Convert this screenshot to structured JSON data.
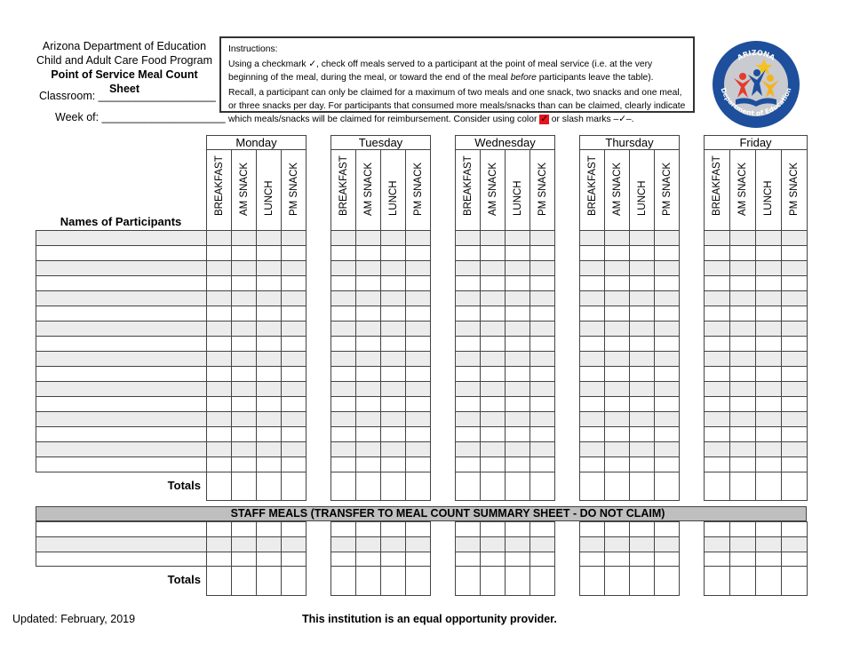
{
  "header": {
    "org": "Arizona Department of Education",
    "program": "Child and Adult Care Food Program",
    "title": "Point of Service Meal Count Sheet",
    "classroom_label": "Classroom: ___________________",
    "week_label": "Week of: ____________________"
  },
  "instructions": {
    "heading": "Instructions:",
    "p1_a": "Using a checkmark ✓, check off meals served to a participant at the point of meal service (i.e. at the very beginning of the meal, during the meal, or toward the end of the meal ",
    "p1_em": "before",
    "p1_b": " participants leave the table).",
    "p2_a": "Recall, a participant can only be claimed for a maximum of two meals and one snack, two snacks and one meal, or three snacks per day. For participants that consumed more meals/snacks than can be claimed, clearly indicate which meals/snacks will be claimed for reimbursement. Consider using color ",
    "p2_check": "✓",
    "p2_b": " or slash marks ",
    "p2_slash": "–✓–",
    "p2_c": "."
  },
  "logo": {
    "text_top": "ARIZONA",
    "text_bottom": "Department of Education"
  },
  "table": {
    "names_header": "Names of Participants",
    "days": [
      "Monday",
      "Tuesday",
      "Wednesday",
      "Thursday",
      "Friday"
    ],
    "meals": [
      "BREAKFAST",
      "AM SNACK",
      "LUNCH",
      "PM SNACK"
    ],
    "totals_label": "Totals",
    "staff_header": "STAFF MEALS (TRANSFER TO MEAL COUNT SUMMARY SHEET - DO NOT CLAIM)",
    "staff_totals_label": "Totals"
  },
  "footer": {
    "updated": "Updated: February, 2019",
    "equal_opportunity": "This institution is an equal opportunity provider."
  },
  "colors": {
    "row_shade": "#ececec",
    "staff_bar": "#bfbfbf",
    "highlight": "#e8141b"
  }
}
